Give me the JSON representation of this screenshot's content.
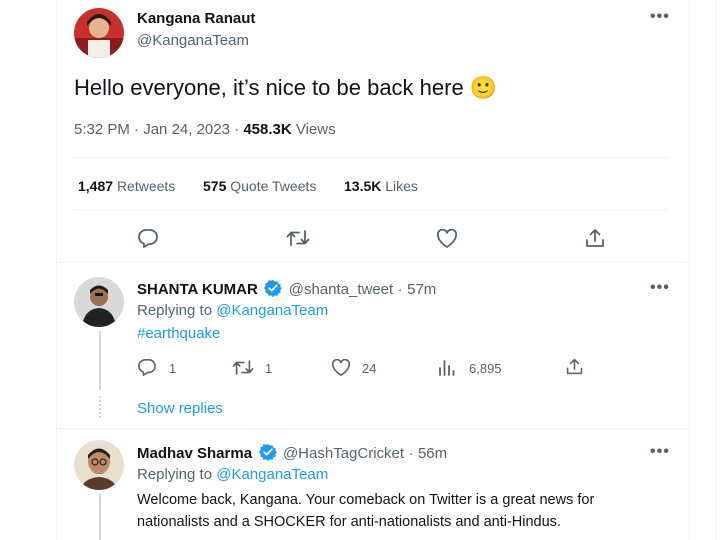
{
  "main_tweet": {
    "author_name": "Kangana Ranaut",
    "author_handle": "@KanganaTeam",
    "text": "Hello everyone, it’s nice to be back here",
    "emoji": "🙂",
    "time": "5:32 PM",
    "date": "Jan 24, 2023",
    "views_count": "458.3K",
    "views_label": "Views",
    "retweets_count": "1,487",
    "retweets_label": "Retweets",
    "quotes_count": "575",
    "quotes_label": "Quote Tweets",
    "likes_count": "13.5K",
    "likes_label": "Likes",
    "more": "•••"
  },
  "replies": [
    {
      "author_name": "SHANTA KUMAR",
      "author_handle": "@shanta_tweet",
      "time": "57m",
      "replying_label": "Replying to",
      "replying_to": "@KanganaTeam",
      "text": "#earthquake",
      "reply_count": "1",
      "retweet_count": "1",
      "like_count": "24",
      "view_count": "6,895",
      "show_replies": "Show replies",
      "more": "•••"
    },
    {
      "author_name": "Madhav Sharma",
      "author_handle": "@HashTagCricket",
      "time": "56m",
      "replying_label": "Replying to",
      "replying_to": "@KanganaTeam",
      "text_line1": "Welcome back, Kangana. Your comeback on Twitter is a great news for",
      "text_line2": "nationalists and a SHOCKER for anti-nationalists and anti-Hindus.",
      "more": "•••"
    }
  ],
  "colors": {
    "accent": "#1d9bf0",
    "verified": "#1d9bf0",
    "muted": "#536471"
  },
  "icons": [
    "reply-icon",
    "retweet-icon",
    "like-icon",
    "share-icon",
    "views-icon",
    "verified-icon"
  ]
}
